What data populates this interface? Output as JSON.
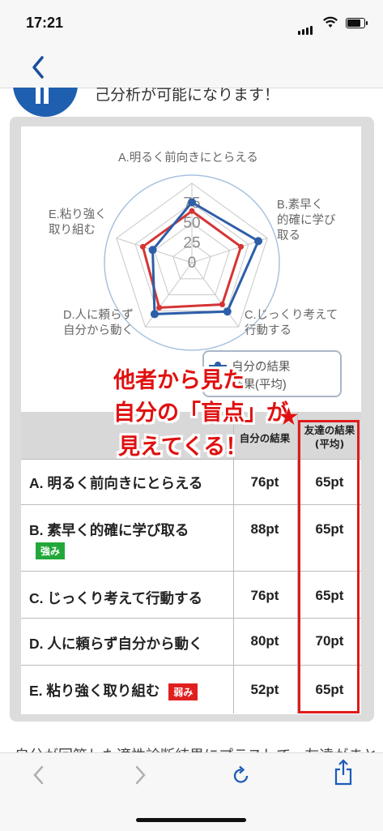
{
  "status_bar": {
    "time": "17:21"
  },
  "nav": {
    "back_icon": "chevron-left-icon"
  },
  "peek_text": "己分析が可能になります！",
  "radar": {
    "ticks": [
      "75",
      "50",
      "25",
      "0"
    ],
    "axes": [
      {
        "line1": "A.明るく前向きにとらえる",
        "line2": ""
      },
      {
        "line1": "B.素早く",
        "line2": "的確に学び",
        "line3": "取る"
      },
      {
        "line1": "C.じっくり考えて",
        "line2": "行動する"
      },
      {
        "line1": "D.人に頼らず",
        "line2": "自分から動く"
      },
      {
        "line1": "E.粘り強く",
        "line2": "取り組む"
      }
    ],
    "legend": {
      "self": "自分の結果",
      "friends": "結果(平均)"
    },
    "colors": {
      "self": "#2d5ea8",
      "friends": "#d63434"
    }
  },
  "chart_data": {
    "type": "radar",
    "categories": [
      "A.明るく前向きにとらえる",
      "B.素早く的確に学び取る",
      "C.じっくり考えて行動する",
      "D.人に頼らず自分から動く",
      "E.粘り強く取り組む"
    ],
    "series": [
      {
        "name": "自分の結果",
        "values": [
          76,
          88,
          76,
          80,
          52
        ]
      },
      {
        "name": "友達の結果(平均)",
        "values": [
          65,
          65,
          65,
          70,
          65
        ]
      }
    ],
    "rlim": [
      0,
      100
    ]
  },
  "table": {
    "header_self": "自分の結果",
    "header_friends_1": "友達の結果",
    "header_friends_2": "(平均)",
    "rows": [
      {
        "label": "A. 明るく前向きにとらえる",
        "self": "76pt",
        "friends": "65pt",
        "badge": ""
      },
      {
        "label": "B. 素早く的確に学び取る",
        "self": "88pt",
        "friends": "65pt",
        "badge": "強み"
      },
      {
        "label": "C. じっくり考えて行動する",
        "self": "76pt",
        "friends": "65pt",
        "badge": ""
      },
      {
        "label": "D. 人に頼らず自分から動く",
        "self": "80pt",
        "friends": "70pt",
        "badge": ""
      },
      {
        "label": "E. 粘り強く取り組む",
        "self": "52pt",
        "friends": "65pt",
        "badge": "弱み"
      }
    ]
  },
  "overlay": {
    "line1": "他者から見た",
    "line2": "自分の「盲点」が",
    "line3": "見えてくる！",
    "star": "★"
  },
  "bottom_text": "自分が回答した適性診断結果にプラスして、友達がまとめ",
  "toolbar": {
    "icons": [
      "chevron-left-icon",
      "chevron-right-icon",
      "reload-icon",
      "share-icon"
    ]
  }
}
